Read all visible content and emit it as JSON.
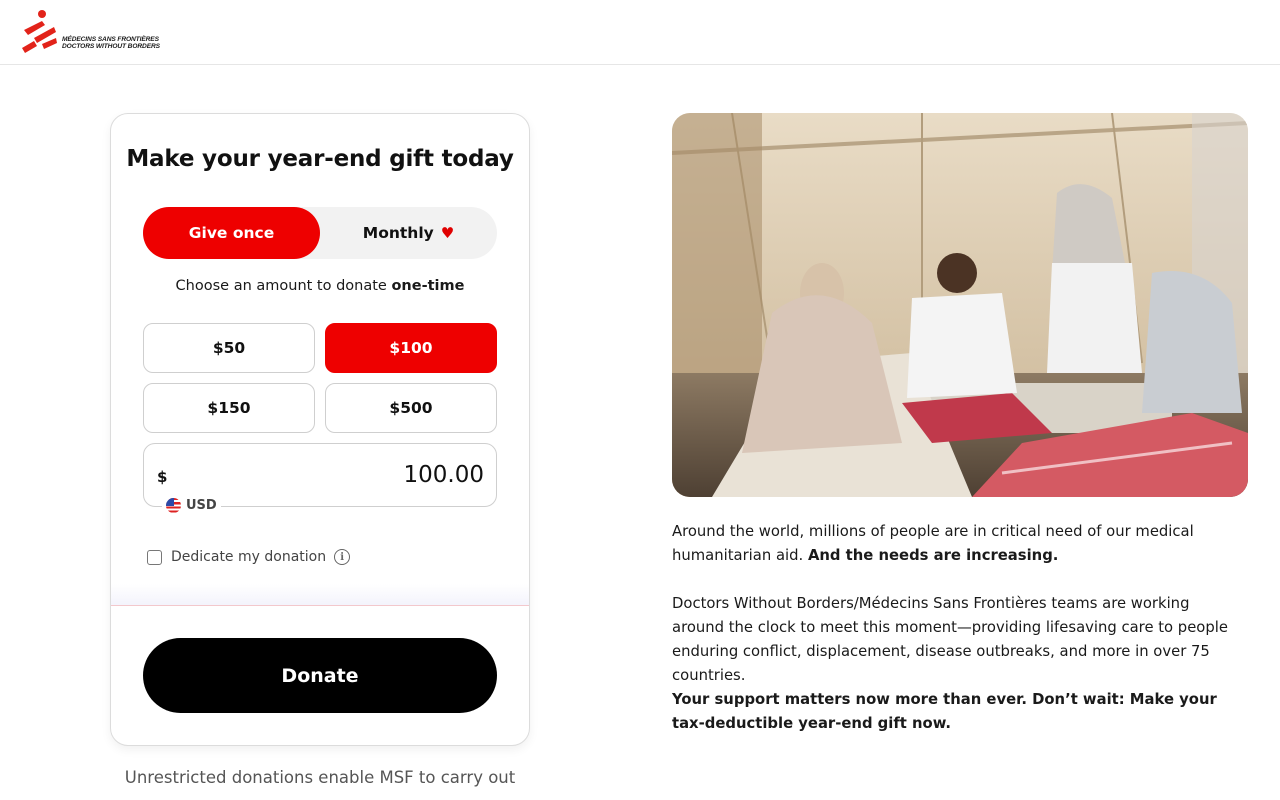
{
  "header": {
    "logo_line1": "MÉDECINS SANS FRONTIÈRES",
    "logo_line2": "DOCTORS WITHOUT BORDERS",
    "logo_icon": "msf-running-man-logo"
  },
  "donation_form": {
    "title": "Make your year-end gift today",
    "frequency": {
      "once_label": "Give once",
      "monthly_label": "Monthly",
      "monthly_icon": "heart-icon",
      "selected": "Give once"
    },
    "amount_caption_prefix": "Choose an amount to donate",
    "amount_caption_bold": "one-time",
    "amounts": [
      {
        "label": "$50",
        "selected": false
      },
      {
        "label": "$100",
        "selected": true
      },
      {
        "label": "$150",
        "selected": false
      },
      {
        "label": "$500",
        "selected": false
      }
    ],
    "custom_amount": {
      "currency_symbol": "$",
      "value": "100.00",
      "currency_code": "USD",
      "flag_icon": "us-flag-icon"
    },
    "dedicate_label": "Dedicate my donation",
    "dedicate_checked": false,
    "donate_label": "Donate"
  },
  "below_card_text": "Unrestricted donations enable MSF to carry out",
  "main": {
    "photo_alt": "MSF medical staff caring for patients in a tent clinic",
    "p1_text": "Around the world, millions of people are in critical need of our medical humanitarian aid.",
    "p1_bold": "And the needs are increasing.",
    "p2_text": "Doctors Without Borders/Médecins Sans Frontières teams are working around the clock to meet this moment—providing lifesaving care to people enduring conflict, displacement, disease outbreaks, and more in over 75 countries.",
    "p3_text": "Your support matters now more than ever. Don’t wait: Make your tax-deductible year-end gift now."
  },
  "colors": {
    "accent_red": "#ee0000",
    "donate_black": "#000000"
  }
}
